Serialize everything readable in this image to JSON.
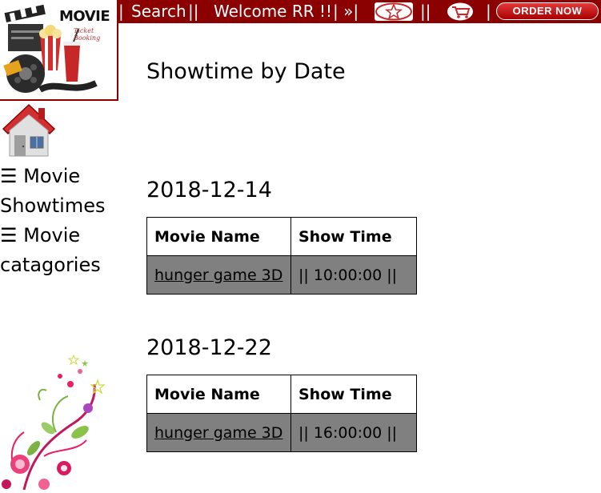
{
  "topbar": {
    "prefix": "| ",
    "search": "Search",
    "sep1": " || ",
    "welcome": "Welcome RR !!",
    "sep2": " | »|",
    "sep3": "||",
    "sep4": "|",
    "order_label": "ORDER NOW",
    "star_icon": "star-icon",
    "cart_icon": "cart-icon",
    "bar_color": "#8b0000"
  },
  "logo": {
    "title": "MOVIE",
    "subtitle": "Ticket Booking"
  },
  "sidebar": {
    "items": [
      {
        "icon": "☰",
        "line1": " Movie",
        "line2": "Showtimes"
      },
      {
        "icon": "☰",
        "line1": " Movie",
        "line2": "catagories"
      }
    ]
  },
  "page": {
    "title": "Showtime by Date"
  },
  "sections": [
    {
      "date": "2018-12-14",
      "headers": [
        "Movie Name",
        "Show Time"
      ],
      "rows": [
        {
          "movie": "hunger game 3D",
          "time": "|| 10:00:00 ||"
        }
      ]
    },
    {
      "date": "2018-12-22",
      "headers": [
        "Movie Name",
        "Show Time"
      ],
      "rows": [
        {
          "movie": "hunger game 3D",
          "time": "|| 16:00:00 ||"
        }
      ]
    }
  ]
}
